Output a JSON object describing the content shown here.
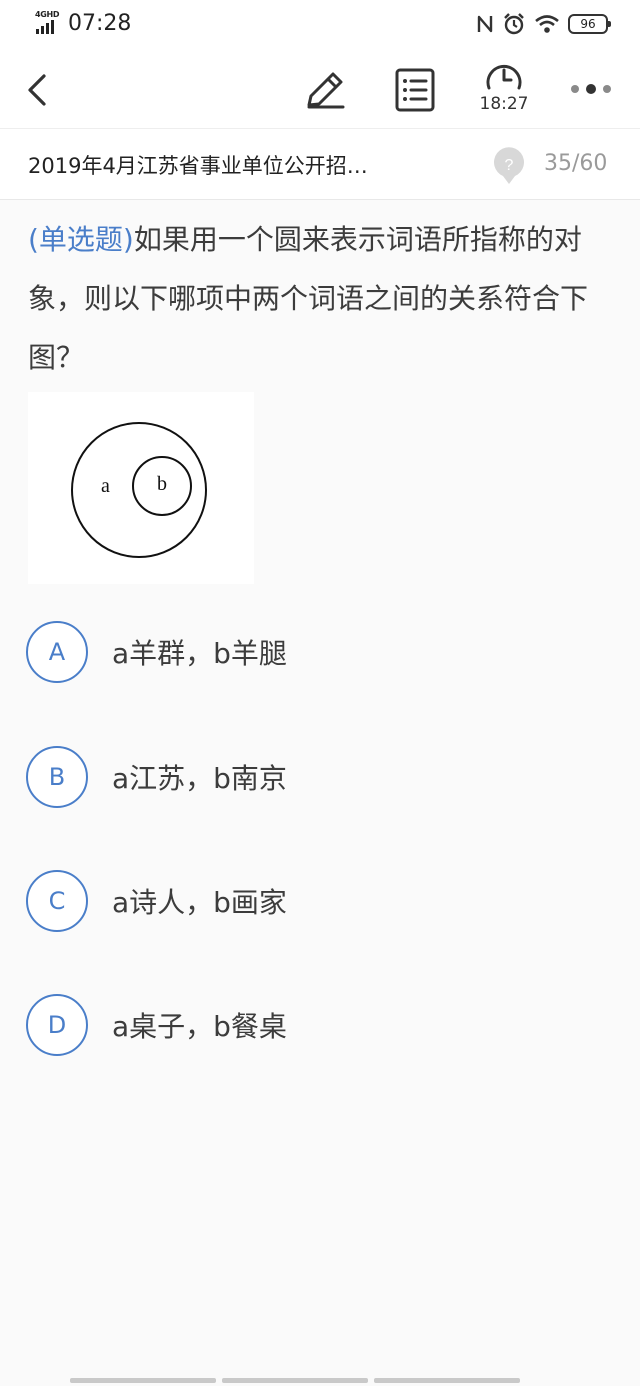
{
  "status_bar": {
    "network": "4GHD",
    "time": "07:28",
    "battery": "96"
  },
  "nav": {
    "timer": "18:27"
  },
  "exam": {
    "title": "2019年4月江苏省事业单位公开招…",
    "progress": "35/60"
  },
  "question": {
    "type_label": "(单选题)",
    "text": "如果用一个圆来表示词语所指称的对象，则以下哪项中两个词语之间的关系符合下图？",
    "figure": {
      "outer_label": "a",
      "inner_label": "b"
    }
  },
  "options": [
    {
      "letter": "A",
      "text": "a羊群，b羊腿"
    },
    {
      "letter": "B",
      "text": "a江苏，b南京"
    },
    {
      "letter": "C",
      "text": "a诗人，b画家"
    },
    {
      "letter": "D",
      "text": "a桌子，b餐桌"
    }
  ],
  "colors": {
    "accent": "#4a7ec9",
    "background": "#fafafa",
    "text": "#3c3c3c",
    "muted": "#9a9a9a"
  },
  "icons": [
    "back-icon",
    "edit-pencil-icon",
    "answer-sheet-list-icon",
    "timer-clock-icon",
    "more-dots-icon",
    "help-question-icon",
    "nfc-icon",
    "alarm-icon",
    "wifi-icon",
    "battery-icon",
    "signal-icon"
  ]
}
